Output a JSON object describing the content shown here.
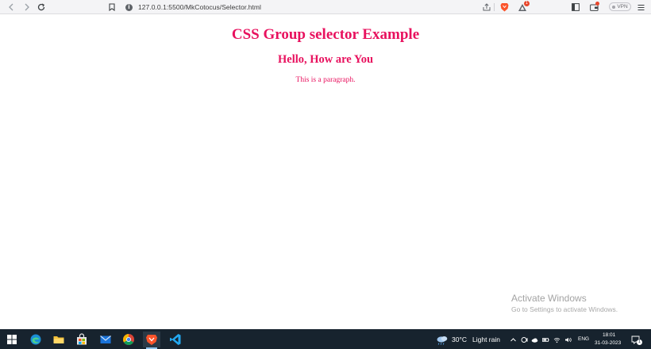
{
  "browser": {
    "url": "127.0.0.1:5500/MkCotocus/Selector.html",
    "rewards_badge": "1",
    "vpn_label": "VPN",
    "info_icon_glyph": "i"
  },
  "page": {
    "heading": "CSS Group selector Example",
    "subheading": "Hello, How are You",
    "paragraph": "This is a paragraph.",
    "text_color": "#e8115e"
  },
  "watermark": {
    "title": "Activate Windows",
    "subtitle": "Go to Settings to activate Windows."
  },
  "taskbar": {
    "apps": [
      "windows-start",
      "edge",
      "file-explorer",
      "microsoft-store",
      "mail",
      "chrome",
      "brave",
      "vscode"
    ],
    "weather": {
      "temperature": "30°C",
      "condition": "Light rain"
    },
    "language": "ENG",
    "time": "18:01",
    "date": "31-03-2023",
    "notification_count": "1"
  },
  "colors": {
    "taskbar_bg": "#17232e",
    "toolbar_bg": "#f4f4f6",
    "accent_brave": "#fb542b"
  }
}
